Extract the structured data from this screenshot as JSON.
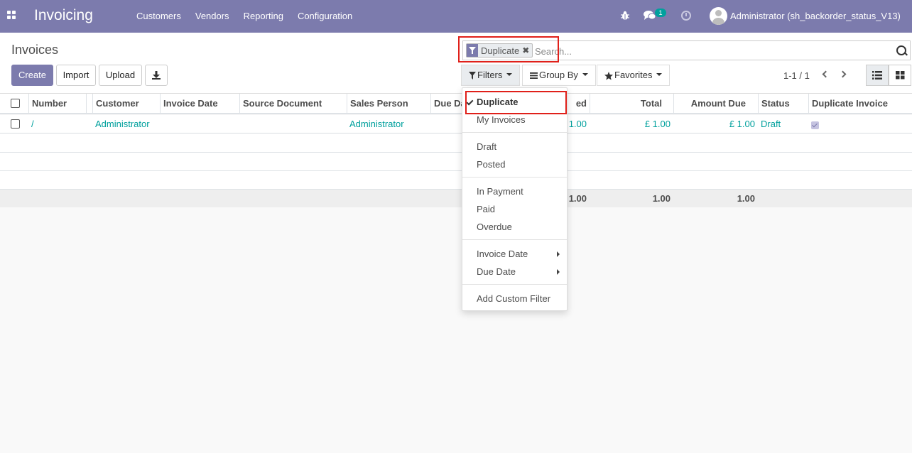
{
  "navbar": {
    "app_title": "Invoicing",
    "menu": [
      "Customers",
      "Vendors",
      "Reporting",
      "Configuration"
    ],
    "chat_count": "1",
    "user": "Administrator (sh_backorder_status_V13)"
  },
  "control": {
    "breadcrumb": "Invoices",
    "buttons": {
      "create": "Create",
      "import": "Import",
      "upload": "Upload"
    },
    "search": {
      "facet": "Duplicate",
      "facet_close": "✖",
      "placeholder": "Search..."
    },
    "filters_label": "Filters",
    "groupby_label": "Group By",
    "favorites_label": "Favorites",
    "pager": "1-1 / 1"
  },
  "table": {
    "headers": {
      "number": "Number",
      "customer": "Customer",
      "invoice_date": "Invoice Date",
      "source_document": "Source Document",
      "sales_person": "Sales Person",
      "due_date": "Due Da",
      "untaxed": "ed",
      "total": "Total",
      "amount_due": "Amount Due",
      "status": "Status",
      "duplicate_invoice": "Duplicate Invoice"
    },
    "row": {
      "number": "/",
      "customer": "Administrator",
      "sales_person": "Administrator",
      "untaxed": "1.00",
      "total": "£ 1.00",
      "amount_due": "£ 1.00",
      "status": "Draft",
      "duplicate_checked": true
    },
    "footer": {
      "untaxed": "1.00",
      "total": "1.00",
      "amount_due": "1.00"
    }
  },
  "filters_dropdown": {
    "items": [
      {
        "label": "Duplicate",
        "checked": true
      },
      {
        "label": "My Invoices"
      },
      {
        "label": "Draft"
      },
      {
        "label": "Posted"
      },
      {
        "label": "In Payment"
      },
      {
        "label": "Paid"
      },
      {
        "label": "Overdue"
      },
      {
        "label": "Invoice Date"
      },
      {
        "label": "Due Date"
      },
      {
        "label": "Add Custom Filter"
      }
    ]
  },
  "colors": {
    "brand": "#7c7bad",
    "link": "#00a09d",
    "highlight": "#e0201a"
  }
}
